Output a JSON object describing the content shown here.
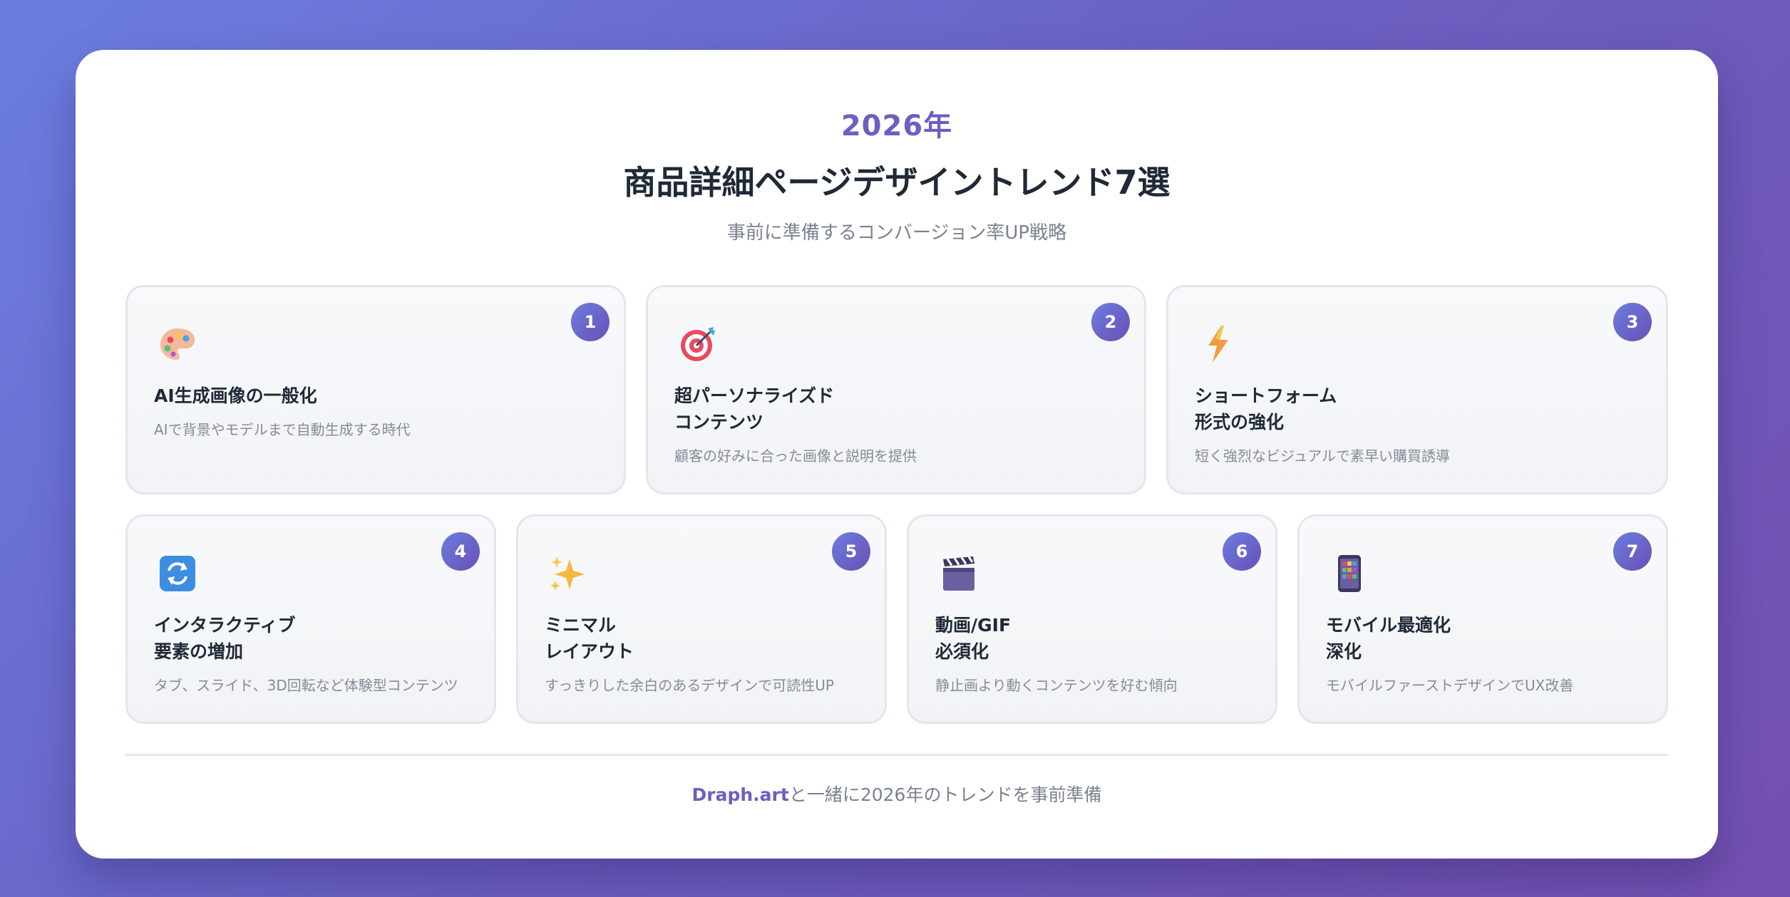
{
  "header": {
    "eyebrow": "2026年",
    "title": "商品詳細ページデザイントレンド7選",
    "subtitle": "事前に準備するコンバージョン率UP戦略"
  },
  "trends": [
    {
      "number": "1",
      "icon": "palette-icon",
      "title": "AI生成画像の一般化",
      "desc": "AIで背景やモデルまで自動生成する時代"
    },
    {
      "number": "2",
      "icon": "target-icon",
      "title": "超パーソナライズド\nコンテンツ",
      "desc": "顧客の好みに合った画像と説明を提供"
    },
    {
      "number": "3",
      "icon": "lightning-icon",
      "title": "ショートフォーム\n形式の強化",
      "desc": "短く強烈なビジュアルで素早い購買誘導"
    },
    {
      "number": "4",
      "icon": "refresh-icon",
      "title": "インタラクティブ\n要素の増加",
      "desc": "タブ、スライド、3D回転など体験型コンテンツ"
    },
    {
      "number": "5",
      "icon": "sparkles-icon",
      "title": "ミニマル\nレイアウト",
      "desc": "すっきりした余白のあるデザインで可読性UP"
    },
    {
      "number": "6",
      "icon": "clapperboard-icon",
      "title": "動画/GIF\n必須化",
      "desc": "静止画より動くコンテンツを好む傾向"
    },
    {
      "number": "7",
      "icon": "mobile-icon",
      "title": "モバイル最適化\n深化",
      "desc": "モバイルファーストデザインでUX改善"
    }
  ],
  "footer": {
    "brand": "Draph.art",
    "text": "と一緒に2026年のトレンドを事前準備"
  },
  "colors": {
    "accent": "#6b5fc2",
    "badge_start": "#6b7ee0",
    "badge_end": "#6a4fb5",
    "title_text": "#1f2937",
    "muted_text": "#858b97"
  }
}
